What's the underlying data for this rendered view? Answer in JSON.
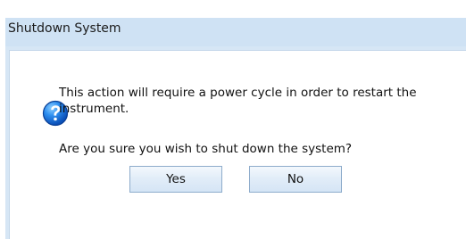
{
  "dialog": {
    "title": "Shutdown System",
    "icon": "question-icon",
    "message_line1": "This action will require a power cycle in order to restart the instrument.",
    "question": "Are you sure you wish to shut down the system?",
    "buttons": {
      "yes_label": "Yes",
      "no_label": "No"
    }
  },
  "colors": {
    "dialog_frame": "#d6e6f5",
    "button_border": "#8eaccb",
    "icon_blue": "#1f66c8"
  }
}
